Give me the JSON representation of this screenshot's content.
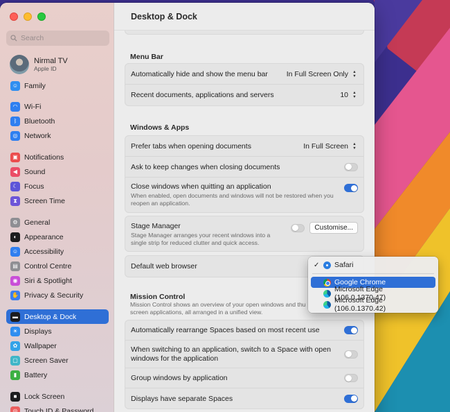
{
  "window": {
    "title": "Desktop & Dock"
  },
  "search": {
    "placeholder": "Search"
  },
  "profile": {
    "name": "Nirmal TV",
    "subtitle": "Apple ID"
  },
  "sidebar": {
    "items": [
      {
        "label": "Family",
        "icon": "family-icon",
        "color": "#2f8ef0"
      },
      {
        "label": "Wi-Fi",
        "icon": "wifi-icon",
        "color": "#2f7ff0"
      },
      {
        "label": "Bluetooth",
        "icon": "bluetooth-icon",
        "color": "#2f7ff0"
      },
      {
        "label": "Network",
        "icon": "network-icon",
        "color": "#2f7ff0"
      },
      {
        "label": "Notifications",
        "icon": "notifications-icon",
        "color": "#eb4d4d"
      },
      {
        "label": "Sound",
        "icon": "sound-icon",
        "color": "#eb4d66"
      },
      {
        "label": "Focus",
        "icon": "focus-icon",
        "color": "#5d55d8"
      },
      {
        "label": "Screen Time",
        "icon": "screen-time-icon",
        "color": "#6d55d8"
      },
      {
        "label": "General",
        "icon": "gear-icon",
        "color": "#8e8e93"
      },
      {
        "label": "Appearance",
        "icon": "appearance-icon",
        "color": "#1c1c1e"
      },
      {
        "label": "Accessibility",
        "icon": "accessibility-icon",
        "color": "#2f7ff0"
      },
      {
        "label": "Control Centre",
        "icon": "control-centre-icon",
        "color": "#8e8e93"
      },
      {
        "label": "Siri & Spotlight",
        "icon": "siri-icon",
        "color": "#c94fd8"
      },
      {
        "label": "Privacy & Security",
        "icon": "hand-icon",
        "color": "#3b7ff0"
      },
      {
        "label": "Desktop & Dock",
        "icon": "dock-icon",
        "color": "#1c1c1e",
        "active": true
      },
      {
        "label": "Displays",
        "icon": "displays-icon",
        "color": "#2f8ef0"
      },
      {
        "label": "Wallpaper",
        "icon": "wallpaper-icon",
        "color": "#33a3e8"
      },
      {
        "label": "Screen Saver",
        "icon": "screen-saver-icon",
        "color": "#3fb6c8"
      },
      {
        "label": "Battery",
        "icon": "battery-icon",
        "color": "#3cb043"
      },
      {
        "label": "Lock Screen",
        "icon": "lock-icon",
        "color": "#1c1c1e"
      },
      {
        "label": "Touch ID & Password",
        "icon": "fingerprint-icon",
        "color": "#ec5e5e"
      }
    ]
  },
  "menu_bar": {
    "title": "Menu Bar",
    "auto_hide_label": "Automatically hide and show the menu bar",
    "auto_hide_value": "In Full Screen Only",
    "recent_label": "Recent documents, applications and servers",
    "recent_value": "10"
  },
  "windows_apps": {
    "title": "Windows & Apps",
    "prefer_tabs_label": "Prefer tabs when opening documents",
    "prefer_tabs_value": "In Full Screen",
    "ask_keep_label": "Ask to keep changes when closing documents",
    "ask_keep_on": false,
    "close_windows_label": "Close windows when quitting an application",
    "close_windows_desc": "When enabled, open documents and windows will not be restored when you reopen an application.",
    "close_windows_on": true,
    "stage_manager_label": "Stage Manager",
    "stage_manager_desc": "Stage Manager arranges your recent windows into a single strip for reduced clutter and quick access.",
    "stage_manager_on": false,
    "customise_label": "Customise...",
    "default_browser_label": "Default web browser"
  },
  "mission_control": {
    "title": "Mission Control",
    "desc": "Mission Control shows an overview of your open windows and thu",
    "desc2": "screen applications, all arranged in a unified view.",
    "rearrange_label": "Automatically rearrange Spaces based on most recent use",
    "rearrange_on": true,
    "switch_label": "When switching to an application, switch to a Space with open windows for the application",
    "switch_on": false,
    "group_label": "Group windows by application",
    "group_on": false,
    "separate_label": "Displays have separate Spaces",
    "separate_on": true
  },
  "browser_menu": {
    "items": [
      {
        "label": "Safari",
        "icon": "safari-icon",
        "checked": true
      },
      {
        "label": "Google Chrome",
        "icon": "chrome-icon",
        "highlighted": true
      },
      {
        "label": "Microsoft Edge (106.0.1370.47)",
        "icon": "edge-icon"
      },
      {
        "label": "Microsoft Edge (106.0.1370.42)",
        "icon": "edge-icon"
      }
    ]
  }
}
